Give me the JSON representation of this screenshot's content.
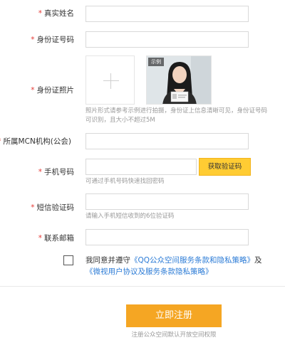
{
  "form": {
    "real_name": {
      "label": "真实姓名",
      "value": ""
    },
    "id_number": {
      "label": "身份证号码",
      "value": ""
    },
    "id_photo": {
      "label": "身份证照片",
      "sample_tag": "示例",
      "hint_line1": "照片形式请参考示例进行拍摄，身份证上信息清晰可见，身份证号码",
      "hint_line2": "可识别，且大小不超过5M"
    },
    "mcn_org": {
      "label": "所属MCN机构(公会)",
      "value": ""
    },
    "phone": {
      "label": "手机号码",
      "value": "",
      "get_code_button": "获取验证码",
      "hint": "可通过手机号码快速找回密码"
    },
    "sms_code": {
      "label": "短信验证码",
      "value": "",
      "hint": "请输入手机短信收到的6位验证码"
    },
    "email": {
      "label": "联系邮箱",
      "value": ""
    },
    "agreement": {
      "checked": false,
      "prefix": "我同意并遵守",
      "link1": "《QQ公众空间服务条款和隐私策略》",
      "middle": "及",
      "link2": "《微视用户协议及服务条款隐私策略》"
    },
    "submit_button": "立即注册",
    "footnote": "注册公众空间默认开放空间权限"
  },
  "colors": {
    "required_star": "#e53935",
    "link": "#2b7bd6",
    "code_button": "#ffcc33",
    "submit_button": "#f5a623",
    "hint_text": "#999999"
  },
  "icons": {
    "upload": "plus-icon"
  }
}
